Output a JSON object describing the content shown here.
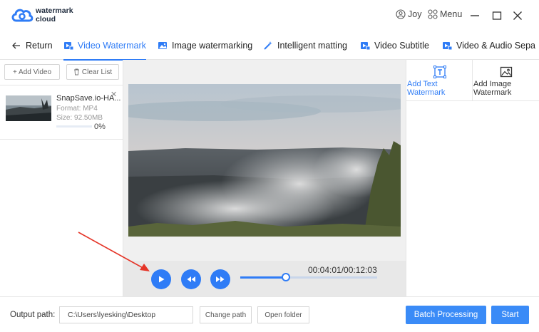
{
  "app": {
    "logo_line1": "watermark",
    "logo_line2": "cloud",
    "user_name": "Joy",
    "menu_label": "Menu",
    "accent_color": "#2f7cf6"
  },
  "tabs": [
    {
      "label": "Return",
      "icon": "arrow-left-icon"
    },
    {
      "label": "Video Watermark",
      "icon": "video-watermark-icon",
      "active": true
    },
    {
      "label": "Image watermarking",
      "icon": "image-icon"
    },
    {
      "label": "Intelligent matting",
      "icon": "magic-wand-icon"
    },
    {
      "label": "Video Subtitle",
      "icon": "subtitle-icon"
    },
    {
      "label": "Video & Audio Sepa",
      "icon": "audio-separate-icon"
    }
  ],
  "left_panel": {
    "add_video_label": "+ Add Video",
    "clear_list_label": "Clear List",
    "file": {
      "name": "SnapSave.io-HA...",
      "format": "Format:  MP4",
      "size": "Size:  92.50MB",
      "progress_text": "0%",
      "progress": 0
    }
  },
  "player": {
    "timecode": "00:04:01/00:12:03",
    "seek_fraction": 0.333
  },
  "right_panel": {
    "add_text_watermark": [
      "Add Text",
      "Watermark"
    ],
    "add_image_watermark": [
      "Add Image",
      "Watermark"
    ]
  },
  "footer": {
    "output_label": "Output path:",
    "output_path": "C:\\Users\\lyesking\\Desktop",
    "change_path_label": "Change path",
    "open_folder_label": "Open folder",
    "batch_label": "Batch Processing",
    "start_label": "Start"
  }
}
